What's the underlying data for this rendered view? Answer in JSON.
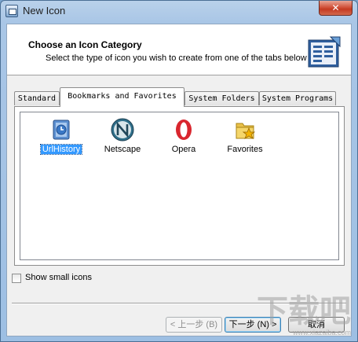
{
  "window": {
    "title": "New Icon",
    "close_glyph": "✕"
  },
  "header": {
    "title": "Choose an Icon Category",
    "subtitle": "Select the type of icon you wish to create from one of the tabs below",
    "icon": "wizard-book-icon"
  },
  "tabs": [
    {
      "label": "Standard",
      "active": false
    },
    {
      "label": "Bookmarks and Favorites",
      "active": true
    },
    {
      "label": "System Folders",
      "active": false
    },
    {
      "label": "System Programs",
      "active": false
    }
  ],
  "items": [
    {
      "label": "UrlHistory",
      "icon": "url-history-icon",
      "selected": true
    },
    {
      "label": "Netscape",
      "icon": "netscape-icon",
      "selected": false
    },
    {
      "label": "Opera",
      "icon": "opera-icon",
      "selected": false
    },
    {
      "label": "Favorites",
      "icon": "favorites-folder-icon",
      "selected": false
    }
  ],
  "options": {
    "show_small_icons_label": "Show small icons",
    "show_small_icons_checked": false
  },
  "buttons": {
    "back": "< 上一步 (B)",
    "next": "下一步 (N) >",
    "cancel": "取消"
  },
  "watermark": {
    "text": "下载吧",
    "url": "www.xiazaiba.com"
  }
}
